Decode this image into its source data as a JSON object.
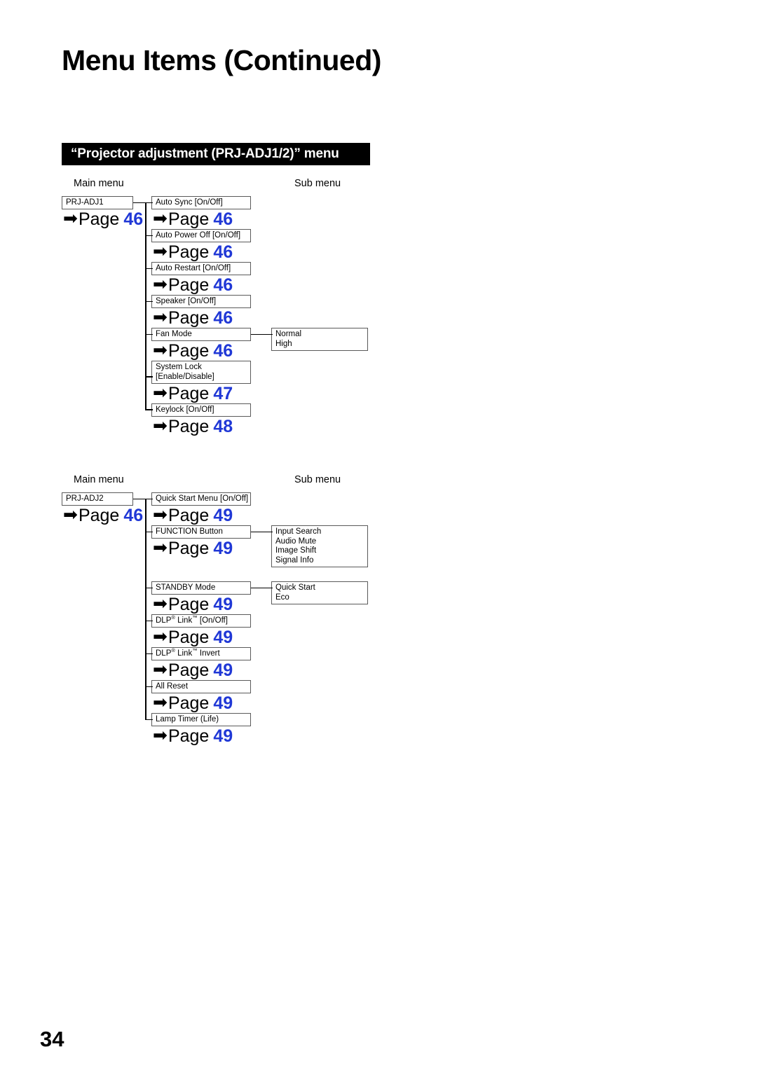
{
  "page": {
    "title": "Menu Items (Continued)",
    "folio": "34",
    "banner": "“Projector adjustment (PRJ-ADJ1/2)” menu",
    "accent_blue": "#2038d6",
    "banner_bg": "#000000"
  },
  "labels": {
    "main_menu": "Main menu",
    "sub_menu": "Sub menu",
    "page_word": "Page",
    "arrow": "➡"
  },
  "diagrams": [
    {
      "id": "prj-adj1",
      "main": {
        "label": "PRJ-ADJ1",
        "page": "46"
      },
      "items": [
        {
          "label": "Auto Sync [On/Off]",
          "page": "46",
          "sub": []
        },
        {
          "label": "Auto Power Off [On/Off]",
          "page": "46",
          "sub": []
        },
        {
          "label": "Auto Restart [On/Off]",
          "page": "46",
          "sub": []
        },
        {
          "label": "Speaker [On/Off]",
          "page": "46",
          "sub": []
        },
        {
          "label": "Fan Mode",
          "page": "46",
          "sub": [
            "Normal",
            "High"
          ]
        },
        {
          "label": "System Lock|[Enable/Disable]",
          "page": "47",
          "sub": []
        },
        {
          "label": "Keylock [On/Off]",
          "page": "48",
          "sub": []
        }
      ]
    },
    {
      "id": "prj-adj2",
      "main": {
        "label": "PRJ-ADJ2",
        "page": "46"
      },
      "items": [
        {
          "label": "Quick Start Menu [On/Off]",
          "page": "49",
          "sub": []
        },
        {
          "label": "FUNCTION Button",
          "page": "49",
          "sub": [
            "Input Search",
            "Audio Mute",
            "Image Shift",
            "Signal Info"
          ]
        },
        {
          "label": "STANDBY Mode",
          "page": "49",
          "sub": [
            "Quick Start",
            "Eco"
          ]
        },
        {
          "label": "DLP® Link™ [On/Off]",
          "page": "49",
          "sub": []
        },
        {
          "label": "DLP® Link™ Invert",
          "page": "49",
          "sub": []
        },
        {
          "label": "All Reset",
          "page": "49",
          "sub": []
        },
        {
          "label": "Lamp Timer (Life)",
          "page": "49",
          "sub": []
        }
      ]
    }
  ]
}
